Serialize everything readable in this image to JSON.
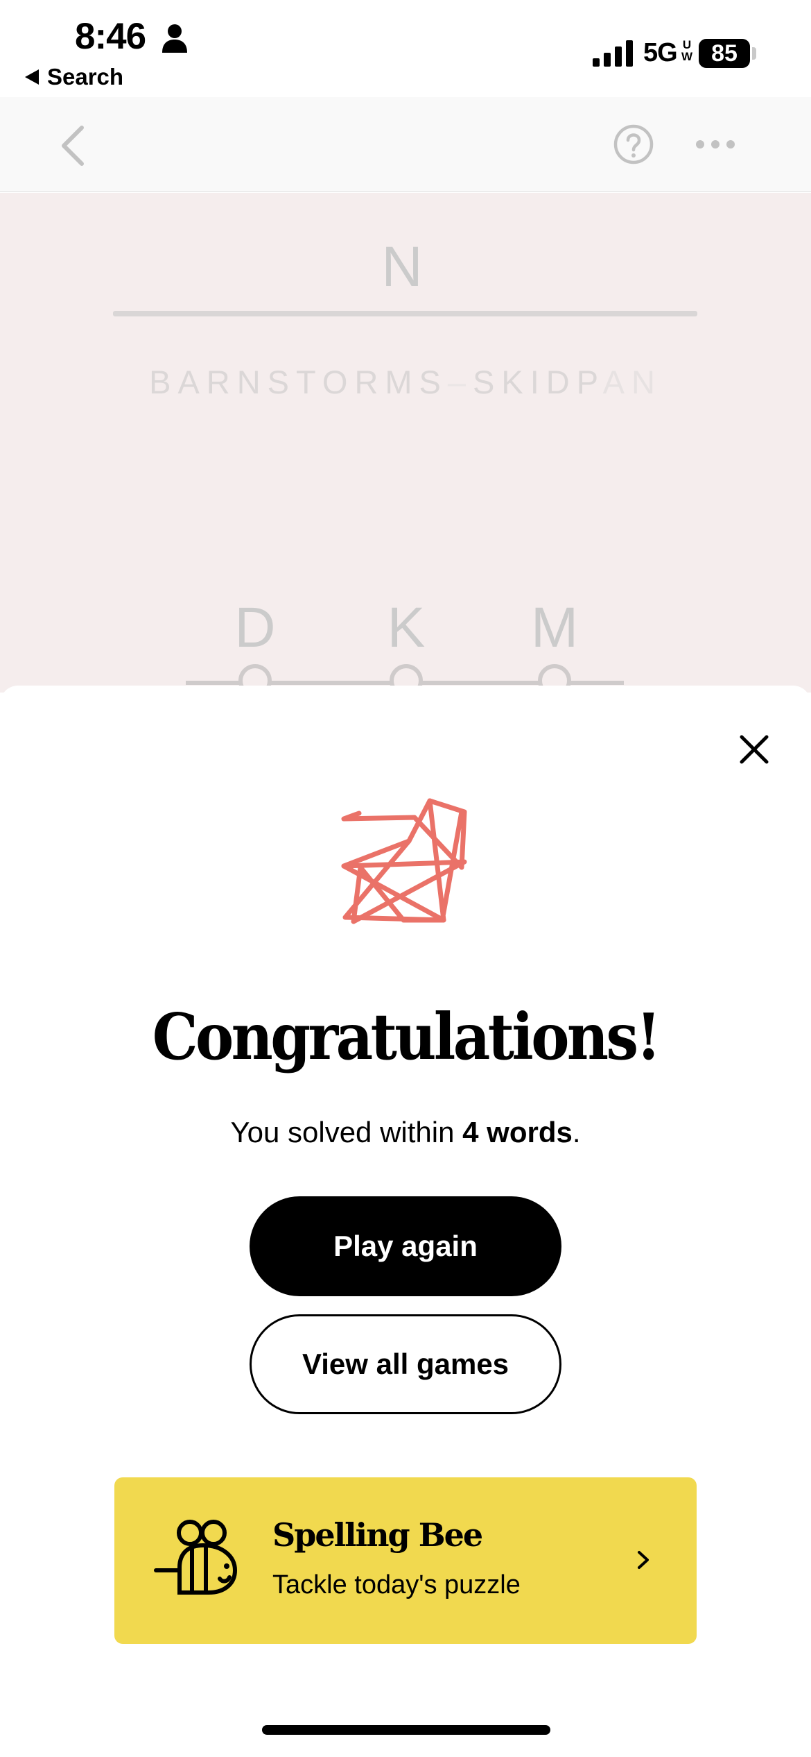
{
  "status_bar": {
    "time": "8:46",
    "back_to_app": "Search",
    "network": "5G",
    "network_sup_top": "U",
    "network_sup_bottom": "W",
    "battery": "85"
  },
  "game": {
    "current_word": "N",
    "chain_left": "BARNSTORMS",
    "chain_separator": "–",
    "chain_right_main": "SKIDP",
    "chain_right_faint": "AN",
    "letters": [
      "D",
      "K",
      "M"
    ]
  },
  "modal": {
    "title": "Congratulations!",
    "result_prefix": "You solved within ",
    "result_bold": "4 words",
    "result_suffix": ".",
    "play_again_label": "Play again",
    "view_all_label": "View all games",
    "promo": {
      "title": "Spelling Bee",
      "subtitle": "Tackle today's puzzle",
      "background_color": "#f1d94f"
    },
    "logo_color": "#ea7268"
  }
}
